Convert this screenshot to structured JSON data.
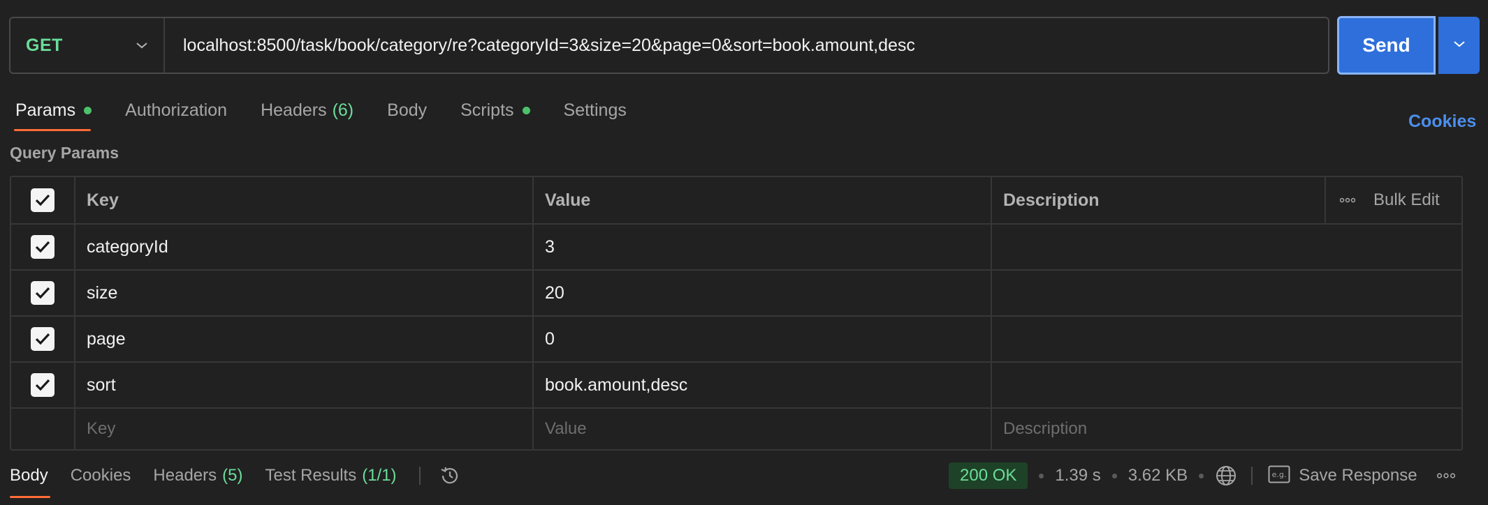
{
  "request": {
    "method": "GET",
    "url": "localhost:8500/task/book/category/re?categoryId=3&size=20&page=0&sort=book.amount,desc",
    "send_label": "Send"
  },
  "tabs": [
    {
      "label": "Params",
      "dot": true,
      "active": true
    },
    {
      "label": "Authorization"
    },
    {
      "label": "Headers",
      "count": "(6)"
    },
    {
      "label": "Body"
    },
    {
      "label": "Scripts",
      "dot": true
    },
    {
      "label": "Settings"
    }
  ],
  "cookies_label": "Cookies",
  "section_title": "Query Params",
  "table": {
    "headers": {
      "key": "Key",
      "value": "Value",
      "description": "Description",
      "bulk_edit": "Bulk Edit"
    },
    "rows": [
      {
        "key": "categoryId",
        "value": "3",
        "description": "",
        "checked": true
      },
      {
        "key": "size",
        "value": "20",
        "description": "",
        "checked": true
      },
      {
        "key": "page",
        "value": "0",
        "description": "",
        "checked": true
      },
      {
        "key": "sort",
        "value": "book.amount,desc",
        "description": "",
        "checked": true
      }
    ],
    "placeholders": {
      "key": "Key",
      "value": "Value",
      "description": "Description"
    }
  },
  "response": {
    "tabs": [
      {
        "label": "Body",
        "active": true
      },
      {
        "label": "Cookies"
      },
      {
        "label": "Headers",
        "count": "(5)"
      },
      {
        "label": "Test Results",
        "count": "(1/1)"
      }
    ],
    "status": "200 OK",
    "time": "1.39 s",
    "size": "3.62 KB",
    "save_label": "Save Response"
  },
  "colors": {
    "accent": "#2e6fdb",
    "method_get": "#6bdd9a",
    "tab_underline": "#ff6c37",
    "status_ok_bg": "#1e4227",
    "link": "#4c8fed"
  }
}
